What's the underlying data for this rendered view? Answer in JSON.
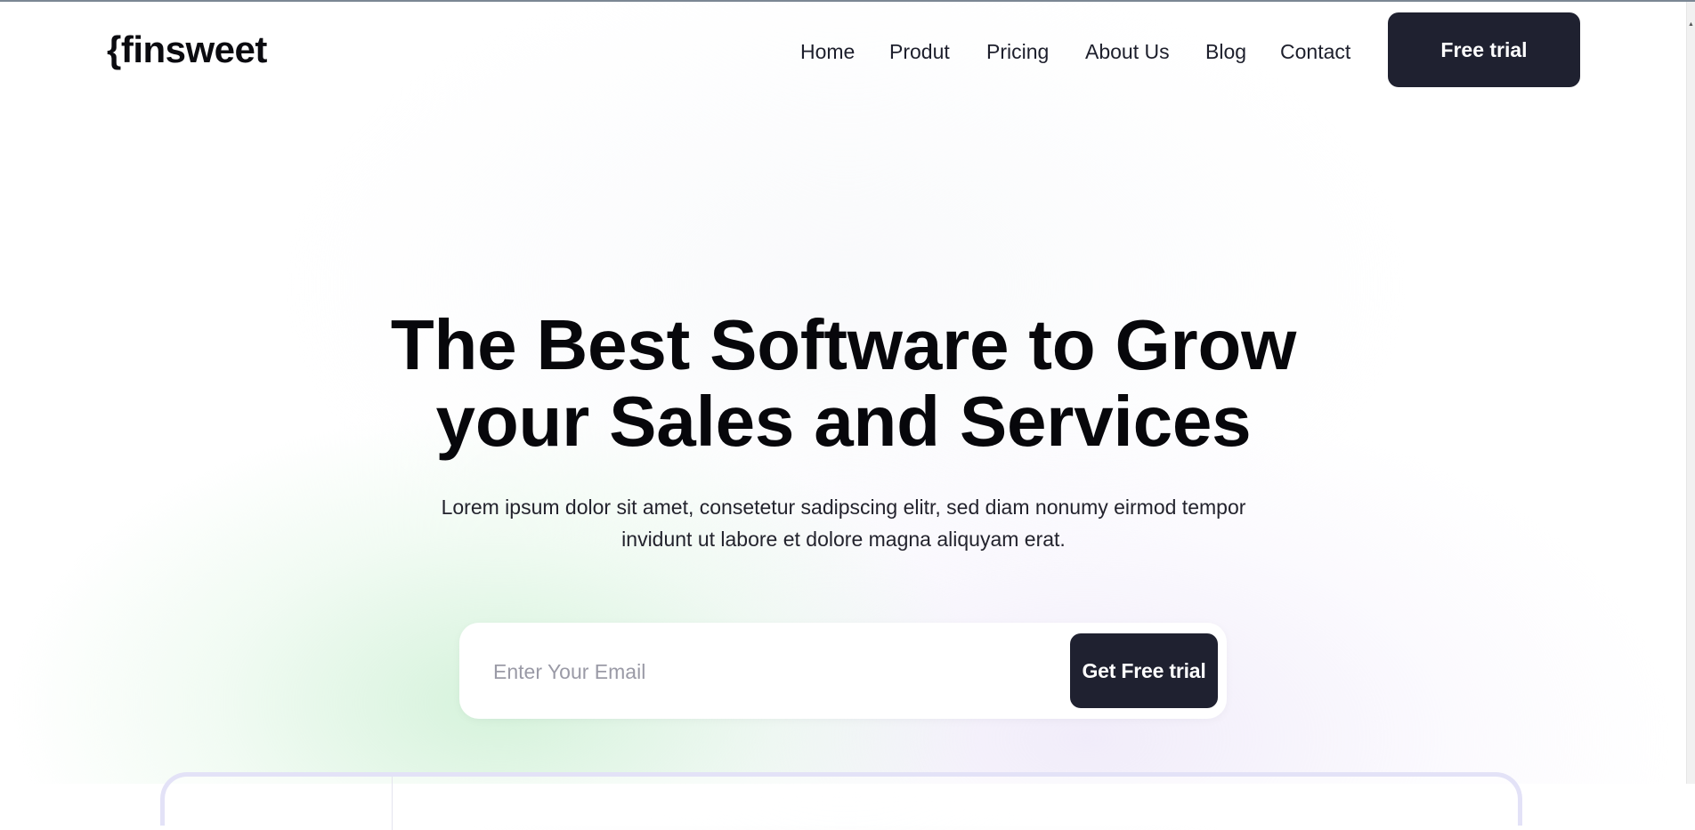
{
  "header": {
    "logo": "{finsweet",
    "nav": [
      {
        "label": "Home"
      },
      {
        "label": "Produt"
      },
      {
        "label": "Pricing"
      },
      {
        "label": "About Us"
      },
      {
        "label": "Blog"
      },
      {
        "label": "Contact"
      }
    ],
    "cta_label": "Free trial"
  },
  "hero": {
    "title_line1": "The Best Software to Grow",
    "title_line2": "your Sales and Services",
    "subtitle_line1": "Lorem ipsum dolor sit amet, consetetur sadipscing elitr, sed diam nonumy eirmod tempor",
    "subtitle_line2": "invidunt ut labore et dolore magna aliquyam erat."
  },
  "signup": {
    "email_placeholder": "Enter Your Email",
    "email_value": "",
    "button_label": "Get Free trial"
  },
  "colors": {
    "primary_dark": "#1f2130",
    "text": "#0b0b10",
    "button_text": "#ffffff",
    "preview_border": "#e3e2f7"
  }
}
